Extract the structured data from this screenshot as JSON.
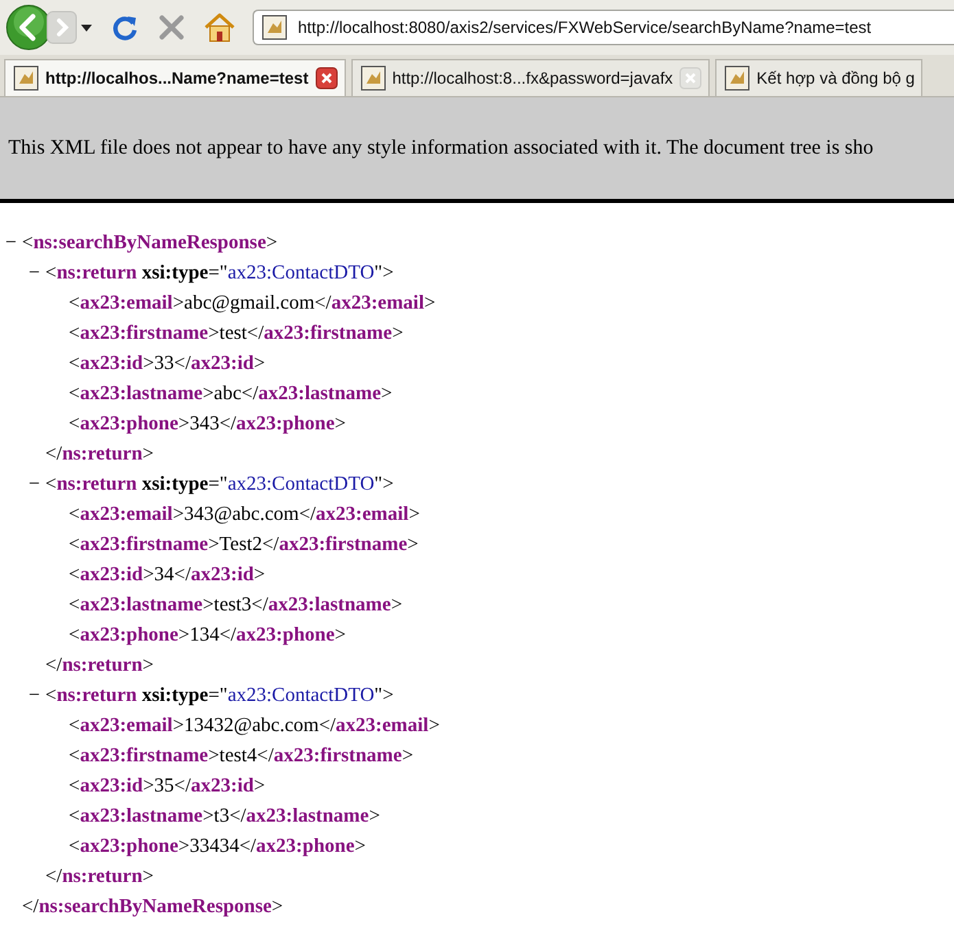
{
  "toolbar": {
    "address": "http://localhost:8080/axis2/services/FXWebService/searchByName?name=test"
  },
  "tabs": [
    {
      "title": "http://localhos...Name?name=test",
      "selected": true
    },
    {
      "title": "http://localhost:8...fx&password=javafx",
      "selected": false
    },
    {
      "title": "Kết hợp và đồng bộ g",
      "selected": false
    }
  ],
  "notice": "This XML file does not appear to have any style information associated with it. The document tree is sho",
  "xml_tree": {
    "toggle": "−",
    "expanded": true,
    "start": [
      {
        "kind": "plain",
        "text": "<"
      },
      {
        "kind": "tag",
        "text": "ns:searchByNameResponse"
      },
      {
        "kind": "plain",
        "text": ">"
      }
    ],
    "end": [
      {
        "kind": "plain",
        "text": "</"
      },
      {
        "kind": "tag",
        "text": "ns:searchByNameResponse"
      },
      {
        "kind": "plain",
        "text": ">"
      }
    ],
    "children": [
      {
        "toggle": "−",
        "expanded": true,
        "start": [
          {
            "kind": "plain",
            "text": "<"
          },
          {
            "kind": "tag",
            "text": "ns:return"
          },
          {
            "kind": "attr",
            "text": " xsi:type"
          },
          {
            "kind": "plain",
            "text": "=\""
          },
          {
            "kind": "value",
            "text": "ax23:ContactDTO"
          },
          {
            "kind": "plain",
            "text": "\">"
          }
        ],
        "end": [
          {
            "kind": "plain",
            "text": "</"
          },
          {
            "kind": "tag",
            "text": "ns:return"
          },
          {
            "kind": "plain",
            "text": ">"
          }
        ],
        "children": [
          {
            "line": [
              {
                "kind": "plain",
                "text": "<"
              },
              {
                "kind": "tag",
                "text": "ax23:email"
              },
              {
                "kind": "plain",
                "text": ">abc@gmail.com</"
              },
              {
                "kind": "tag",
                "text": "ax23:email"
              },
              {
                "kind": "plain",
                "text": ">"
              }
            ]
          },
          {
            "line": [
              {
                "kind": "plain",
                "text": "<"
              },
              {
                "kind": "tag",
                "text": "ax23:firstname"
              },
              {
                "kind": "plain",
                "text": ">test</"
              },
              {
                "kind": "tag",
                "text": "ax23:firstname"
              },
              {
                "kind": "plain",
                "text": ">"
              }
            ]
          },
          {
            "line": [
              {
                "kind": "plain",
                "text": "<"
              },
              {
                "kind": "tag",
                "text": "ax23:id"
              },
              {
                "kind": "plain",
                "text": ">33</"
              },
              {
                "kind": "tag",
                "text": "ax23:id"
              },
              {
                "kind": "plain",
                "text": ">"
              }
            ]
          },
          {
            "line": [
              {
                "kind": "plain",
                "text": "<"
              },
              {
                "kind": "tag",
                "text": "ax23:lastname"
              },
              {
                "kind": "plain",
                "text": ">abc</"
              },
              {
                "kind": "tag",
                "text": "ax23:lastname"
              },
              {
                "kind": "plain",
                "text": ">"
              }
            ]
          },
          {
            "line": [
              {
                "kind": "plain",
                "text": "<"
              },
              {
                "kind": "tag",
                "text": "ax23:phone"
              },
              {
                "kind": "plain",
                "text": ">343</"
              },
              {
                "kind": "tag",
                "text": "ax23:phone"
              },
              {
                "kind": "plain",
                "text": ">"
              }
            ]
          }
        ]
      },
      {
        "toggle": "−",
        "expanded": true,
        "start": [
          {
            "kind": "plain",
            "text": "<"
          },
          {
            "kind": "tag",
            "text": "ns:return"
          },
          {
            "kind": "attr",
            "text": " xsi:type"
          },
          {
            "kind": "plain",
            "text": "=\""
          },
          {
            "kind": "value",
            "text": "ax23:ContactDTO"
          },
          {
            "kind": "plain",
            "text": "\">"
          }
        ],
        "end": [
          {
            "kind": "plain",
            "text": "</"
          },
          {
            "kind": "tag",
            "text": "ns:return"
          },
          {
            "kind": "plain",
            "text": ">"
          }
        ],
        "children": [
          {
            "line": [
              {
                "kind": "plain",
                "text": "<"
              },
              {
                "kind": "tag",
                "text": "ax23:email"
              },
              {
                "kind": "plain",
                "text": ">343@abc.com</"
              },
              {
                "kind": "tag",
                "text": "ax23:email"
              },
              {
                "kind": "plain",
                "text": ">"
              }
            ]
          },
          {
            "line": [
              {
                "kind": "plain",
                "text": "<"
              },
              {
                "kind": "tag",
                "text": "ax23:firstname"
              },
              {
                "kind": "plain",
                "text": ">Test2</"
              },
              {
                "kind": "tag",
                "text": "ax23:firstname"
              },
              {
                "kind": "plain",
                "text": ">"
              }
            ]
          },
          {
            "line": [
              {
                "kind": "plain",
                "text": "<"
              },
              {
                "kind": "tag",
                "text": "ax23:id"
              },
              {
                "kind": "plain",
                "text": ">34</"
              },
              {
                "kind": "tag",
                "text": "ax23:id"
              },
              {
                "kind": "plain",
                "text": ">"
              }
            ]
          },
          {
            "line": [
              {
                "kind": "plain",
                "text": "<"
              },
              {
                "kind": "tag",
                "text": "ax23:lastname"
              },
              {
                "kind": "plain",
                "text": ">test3</"
              },
              {
                "kind": "tag",
                "text": "ax23:lastname"
              },
              {
                "kind": "plain",
                "text": ">"
              }
            ]
          },
          {
            "line": [
              {
                "kind": "plain",
                "text": "<"
              },
              {
                "kind": "tag",
                "text": "ax23:phone"
              },
              {
                "kind": "plain",
                "text": ">134</"
              },
              {
                "kind": "tag",
                "text": "ax23:phone"
              },
              {
                "kind": "plain",
                "text": ">"
              }
            ]
          }
        ]
      },
      {
        "toggle": "−",
        "expanded": true,
        "start": [
          {
            "kind": "plain",
            "text": "<"
          },
          {
            "kind": "tag",
            "text": "ns:return"
          },
          {
            "kind": "attr",
            "text": " xsi:type"
          },
          {
            "kind": "plain",
            "text": "=\""
          },
          {
            "kind": "value",
            "text": "ax23:ContactDTO"
          },
          {
            "kind": "plain",
            "text": "\">"
          }
        ],
        "end": [
          {
            "kind": "plain",
            "text": "</"
          },
          {
            "kind": "tag",
            "text": "ns:return"
          },
          {
            "kind": "plain",
            "text": ">"
          }
        ],
        "children": [
          {
            "line": [
              {
                "kind": "plain",
                "text": "<"
              },
              {
                "kind": "tag",
                "text": "ax23:email"
              },
              {
                "kind": "plain",
                "text": ">13432@abc.com</"
              },
              {
                "kind": "tag",
                "text": "ax23:email"
              },
              {
                "kind": "plain",
                "text": ">"
              }
            ]
          },
          {
            "line": [
              {
                "kind": "plain",
                "text": "<"
              },
              {
                "kind": "tag",
                "text": "ax23:firstname"
              },
              {
                "kind": "plain",
                "text": ">test4</"
              },
              {
                "kind": "tag",
                "text": "ax23:firstname"
              },
              {
                "kind": "plain",
                "text": ">"
              }
            ]
          },
          {
            "line": [
              {
                "kind": "plain",
                "text": "<"
              },
              {
                "kind": "tag",
                "text": "ax23:id"
              },
              {
                "kind": "plain",
                "text": ">35</"
              },
              {
                "kind": "tag",
                "text": "ax23:id"
              },
              {
                "kind": "plain",
                "text": ">"
              }
            ]
          },
          {
            "line": [
              {
                "kind": "plain",
                "text": "<"
              },
              {
                "kind": "tag",
                "text": "ax23:lastname"
              },
              {
                "kind": "plain",
                "text": ">t3</"
              },
              {
                "kind": "tag",
                "text": "ax23:lastname"
              },
              {
                "kind": "plain",
                "text": ">"
              }
            ]
          },
          {
            "line": [
              {
                "kind": "plain",
                "text": "<"
              },
              {
                "kind": "tag",
                "text": "ax23:phone"
              },
              {
                "kind": "plain",
                "text": ">33434</"
              },
              {
                "kind": "tag",
                "text": "ax23:phone"
              },
              {
                "kind": "plain",
                "text": ">"
              }
            ]
          }
        ]
      }
    ]
  }
}
